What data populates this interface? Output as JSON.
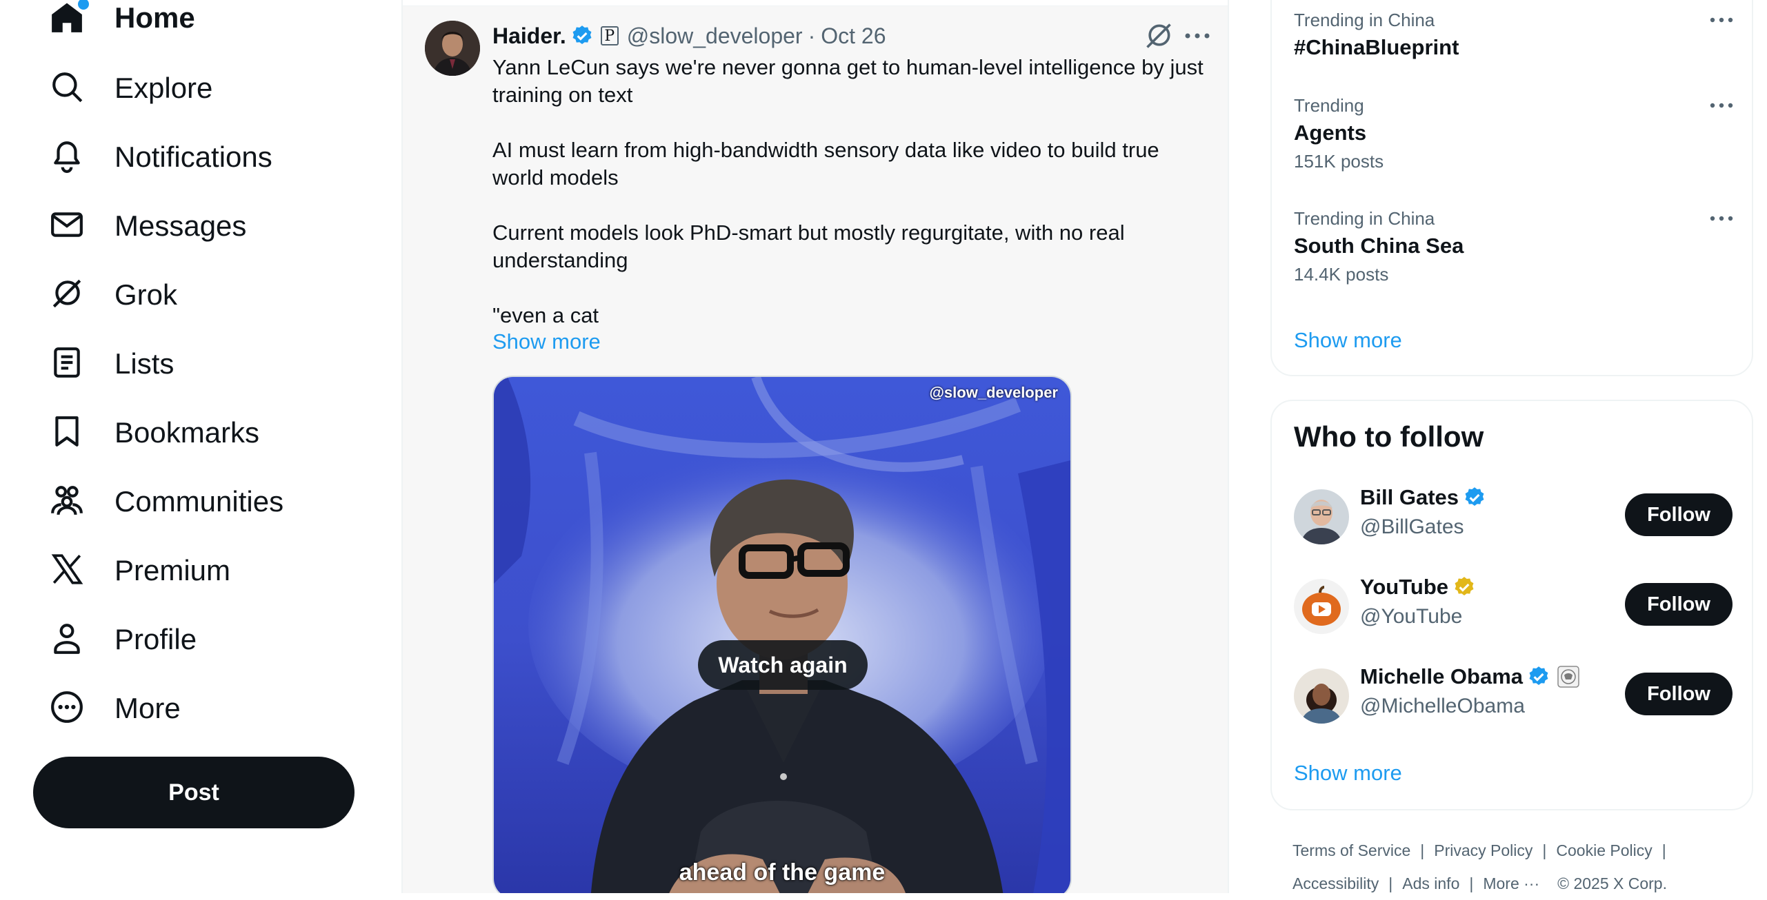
{
  "nav": {
    "items": [
      {
        "label": "Home",
        "icon": "home-icon"
      },
      {
        "label": "Explore",
        "icon": "search-icon"
      },
      {
        "label": "Notifications",
        "icon": "bell-icon"
      },
      {
        "label": "Messages",
        "icon": "envelope-icon"
      },
      {
        "label": "Grok",
        "icon": "grok-icon"
      },
      {
        "label": "Lists",
        "icon": "list-icon"
      },
      {
        "label": "Bookmarks",
        "icon": "bookmark-icon"
      },
      {
        "label": "Communities",
        "icon": "people-icon"
      },
      {
        "label": "Premium",
        "icon": "x-logo-icon"
      },
      {
        "label": "Profile",
        "icon": "person-icon"
      },
      {
        "label": "More",
        "icon": "more-circle-icon"
      }
    ],
    "post_label": "Post"
  },
  "tweet": {
    "author": "Haider.",
    "handle": "@slow_developer",
    "separator": "·",
    "date": "Oct 26",
    "paragraphs": [
      "Yann LeCun says we're never gonna get to human-level intelligence by just training on text",
      "AI must learn from high-bandwidth sensory data like video to build true world models",
      "Current models look PhD-smart but mostly regurgitate, with no real understanding",
      "\"even a cat"
    ],
    "show_more": "Show more",
    "media": {
      "watermark": "@slow_developer",
      "watch_again": "Watch again",
      "caption": "ahead of the game"
    }
  },
  "trending": {
    "items": [
      {
        "meta": "Trending in China",
        "title": "#ChinaBlueprint",
        "count": ""
      },
      {
        "meta": "Trending",
        "title": "Agents",
        "count": "151K posts"
      },
      {
        "meta": "Trending in China",
        "title": "South China Sea",
        "count": "14.4K posts"
      }
    ],
    "show_more": "Show more"
  },
  "who_to_follow": {
    "title": "Who to follow",
    "accounts": [
      {
        "name": "Bill Gates",
        "handle": "@BillGates",
        "badge": "blue",
        "follow": "Follow"
      },
      {
        "name": "YouTube",
        "handle": "@YouTube",
        "badge": "gold",
        "follow": "Follow"
      },
      {
        "name": "Michelle Obama",
        "handle": "@MichelleObama",
        "badge": "blue",
        "follow": "Follow"
      }
    ],
    "show_more": "Show more"
  },
  "footer": {
    "links": [
      "Terms of Service",
      "Privacy Policy",
      "Cookie Policy",
      "Accessibility",
      "Ads info",
      "More ···"
    ],
    "copyright": "© 2025 X Corp."
  },
  "colors": {
    "accent": "#1d9bf0",
    "text": "#0f1419",
    "muted": "#536471",
    "gold": "#e2b719"
  }
}
